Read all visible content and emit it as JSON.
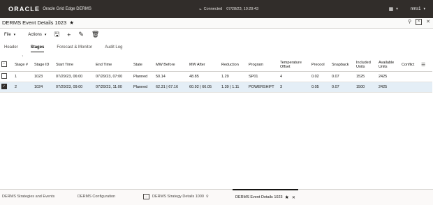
{
  "topbar": {
    "logo": "ORACLE",
    "app_name": "Oracle Grid Edge DERMS",
    "plug_icon": "plug-icon",
    "connection_status": "Connected",
    "datetime": "07/28/23, 10:29:43",
    "grid_icon": "grid-icon",
    "user": "nms1"
  },
  "titlebar": {
    "title": "DERMS Event Details 1023",
    "star": "★"
  },
  "toolbar": {
    "file_label": "File",
    "actions_label": "Actions"
  },
  "tabs": [
    {
      "label": "Header"
    },
    {
      "label": "Stages"
    },
    {
      "label": "Forecast & Monitor"
    },
    {
      "label": "Audit Log"
    }
  ],
  "table": {
    "sort_indicator": "↑",
    "headers": [
      "Stage #",
      "Stage ID",
      "Start Time",
      "End Time",
      "State",
      "MW Before",
      "MW After",
      "Reduction",
      "Program",
      "Temperature Offset",
      "Precool",
      "Snapback",
      "Included Units",
      "Available Units",
      "Conflict"
    ],
    "rows": [
      {
        "selected": false,
        "cells": [
          "1",
          "1023",
          "07/29/23, 06:00",
          "07/29/23, 07:00",
          "Planned",
          "50.14",
          "48.85",
          "1.29",
          "SP01",
          "4",
          "0.02",
          "0.07",
          "1525",
          "2425",
          ""
        ]
      },
      {
        "selected": true,
        "cells": [
          "2",
          "1024",
          "07/29/23, 09:00",
          "07/29/23, 11:00",
          "Planned",
          "62.31 | 67.16",
          "60.92 | 66.05",
          "1.39 | 1.11",
          "POWERSHIFT",
          "3",
          "0.05",
          "0.07",
          "1500",
          "2425",
          ""
        ]
      }
    ]
  },
  "bottom_tabs": [
    {
      "label": "DERMS Strategies and Events"
    },
    {
      "label": "DERMS Configuration"
    },
    {
      "label": "DERMS Strategy Details 1000"
    },
    {
      "label": "DERMS Event Details 1023"
    }
  ]
}
